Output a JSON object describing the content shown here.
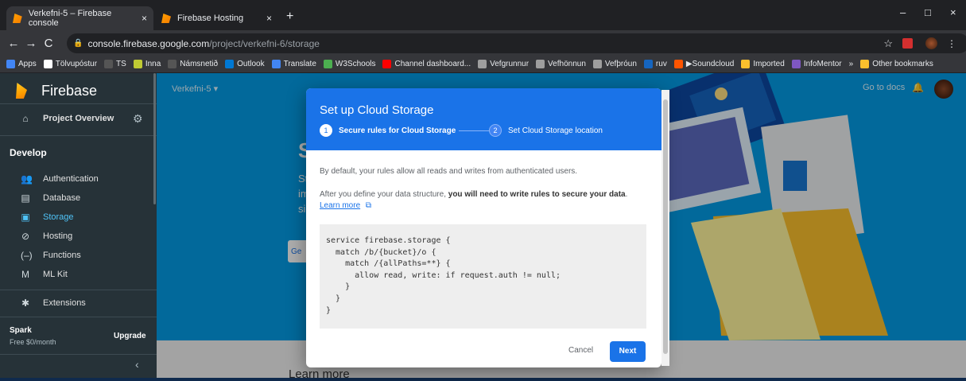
{
  "tabs": [
    {
      "label": "Verkefni-5 – Firebase console",
      "close": "×"
    },
    {
      "label": "Firebase Hosting",
      "close": "×"
    }
  ],
  "new_tab": "+",
  "window": {
    "minimize": "–",
    "maximize": "□",
    "close": "×"
  },
  "address": {
    "domain": "console.firebase.google.com",
    "path": "/project/verkefni-6/storage"
  },
  "bookmarks": [
    {
      "label": "Apps",
      "color": "#4285f4"
    },
    {
      "label": "Tölvupóstur",
      "color": "#ffffff"
    },
    {
      "label": "TS",
      "color": "#555555"
    },
    {
      "label": "Inna",
      "color": "#c0ca33"
    },
    {
      "label": "Námsnetið",
      "color": "#555555"
    },
    {
      "label": "Outlook",
      "color": "#0078d4"
    },
    {
      "label": "Translate",
      "color": "#4285f4"
    },
    {
      "label": "W3Schools",
      "color": "#4caf50"
    },
    {
      "label": "Channel dashboard...",
      "color": "#ff0000"
    },
    {
      "label": "Vefgrunnur",
      "color": "#9e9e9e"
    },
    {
      "label": "Vefhönnun",
      "color": "#9e9e9e"
    },
    {
      "label": "Vefþróun",
      "color": "#9e9e9e"
    },
    {
      "label": "ruv",
      "color": "#1565c0"
    },
    {
      "label": "▶Soundcloud",
      "color": "#ff5500"
    },
    {
      "label": "Imported",
      "color": "#fbc02d"
    },
    {
      "label": "InfoMentor",
      "color": "#7e57c2"
    },
    {
      "label": "»",
      "color": ""
    },
    {
      "label": "Other bookmarks",
      "color": "#fbc02d"
    }
  ],
  "sidebar": {
    "title": "Firebase",
    "project_overview": "Project Overview",
    "section": "Develop",
    "items": [
      {
        "label": "Authentication",
        "icon": "people-icon",
        "glyph": "👥"
      },
      {
        "label": "Database",
        "icon": "database-icon",
        "glyph": "▤"
      },
      {
        "label": "Storage",
        "icon": "image-icon",
        "glyph": "▣"
      },
      {
        "label": "Hosting",
        "icon": "hosting-icon",
        "glyph": "⊘"
      },
      {
        "label": "Functions",
        "icon": "functions-icon",
        "glyph": "(–)"
      },
      {
        "label": "ML Kit",
        "icon": "mlkit-icon",
        "glyph": "M"
      }
    ],
    "extensions": "Extensions",
    "plan": "Spark",
    "plan_price": "Free $0/month",
    "upgrade": "Upgrade",
    "collapse": "‹"
  },
  "header": {
    "project": "Verkefni-5",
    "docs": "Go to docs"
  },
  "background": {
    "heading": "St",
    "line1": "Sto",
    "line2": "ima",
    "line3": "sid",
    "btn": "Ge",
    "learn": "Learn more"
  },
  "modal": {
    "title": "Set up Cloud Storage",
    "step1_num": "1",
    "step1": "Secure rules for Cloud Storage",
    "step2_num": "2",
    "step2": "Set Cloud Storage location",
    "p1": "By default, your rules allow all reads and writes from authenticated users.",
    "p2a": "After you define your data structure, ",
    "p2b": "you will need to write rules to secure your data",
    "p2c": ".",
    "learn_more": "Learn more",
    "code": "service firebase.storage {\n  match /b/{bucket}/o {\n    match /{allPaths=**} {\n      allow read, write: if request.auth != null;\n    }\n  }\n}",
    "cancel": "Cancel",
    "next": "Next"
  },
  "colors": {
    "accent": "#1a73e8",
    "firebase_nav": "#263238",
    "main_bg": "#039be5"
  }
}
